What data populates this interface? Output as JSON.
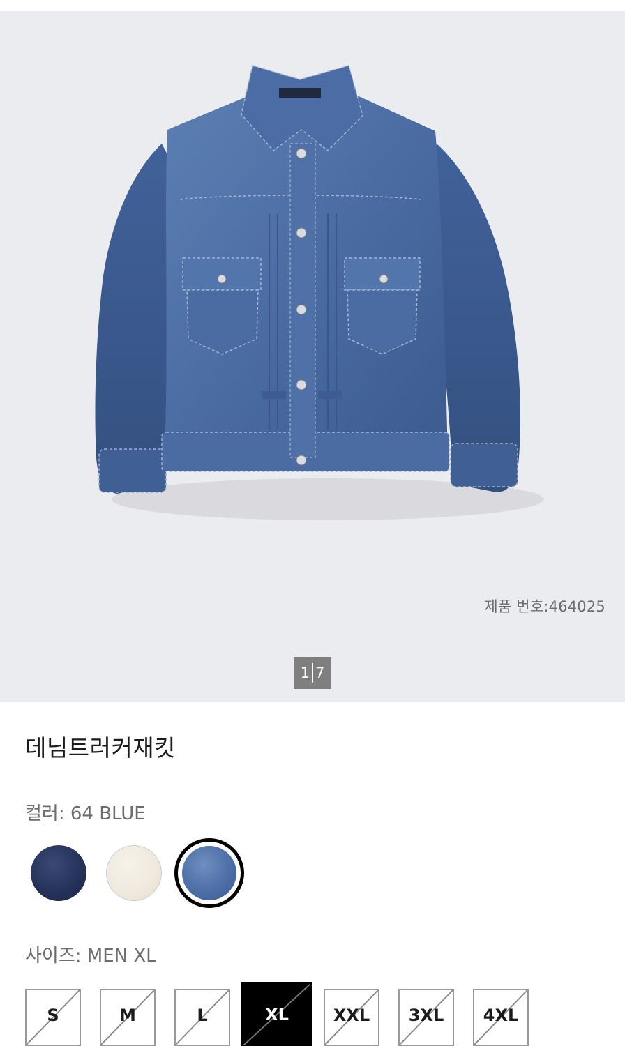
{
  "product": {
    "code_text": "제품 번호:464025",
    "name": "데님트러커재킷"
  },
  "gallery": {
    "current": "1",
    "total": "7"
  },
  "color": {
    "label": "컬러: 64 BLUE",
    "options": [
      {
        "name": "navy",
        "hex": "#26325a"
      },
      {
        "name": "natural",
        "hex": "#efe9dd"
      },
      {
        "name": "blue",
        "hex": "#4d6ea7",
        "selected": true
      }
    ]
  },
  "size": {
    "label": "사이즈: MEN XL",
    "options": [
      {
        "label": "S",
        "available": false
      },
      {
        "label": "M",
        "available": false
      },
      {
        "label": "L",
        "available": false
      },
      {
        "label": "XL",
        "available": false,
        "selected": true
      },
      {
        "label": "XXL",
        "available": false
      },
      {
        "label": "3XL",
        "available": false
      },
      {
        "label": "4XL",
        "available": false
      }
    ]
  },
  "icons": {
    "unavailable": "diagonal-slash-icon"
  }
}
